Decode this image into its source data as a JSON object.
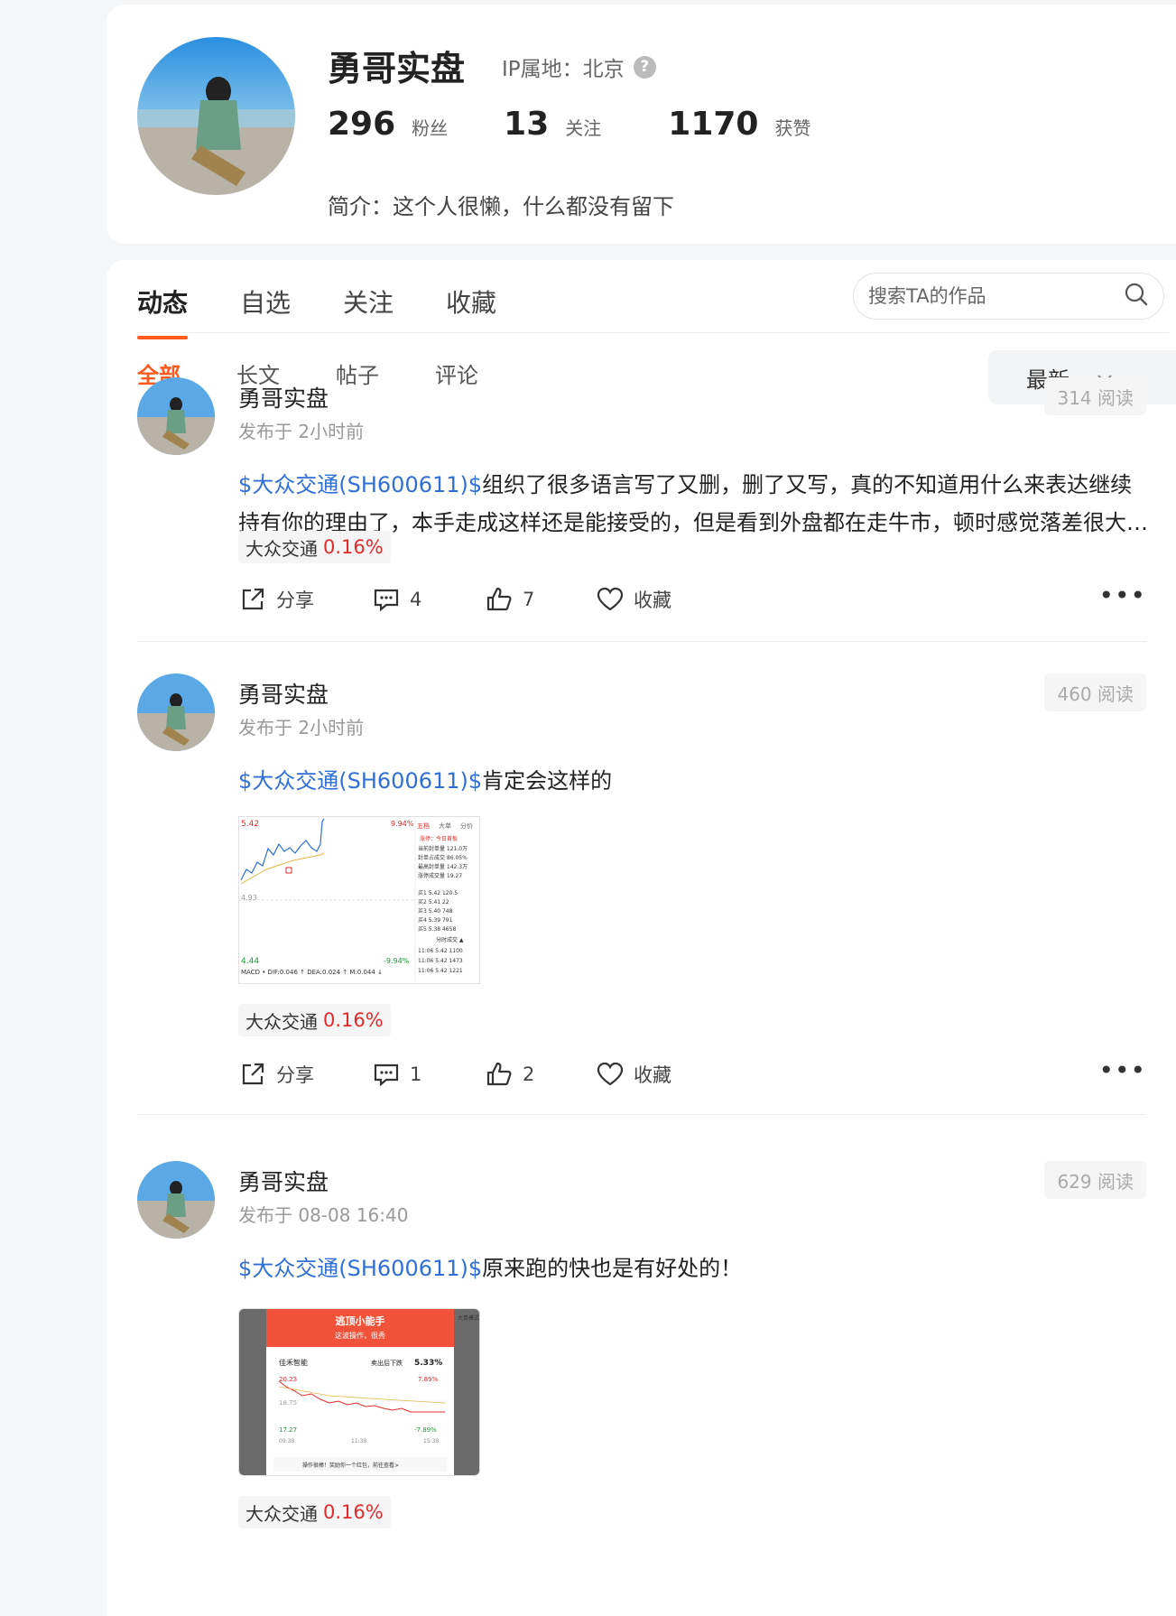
{
  "profile": {
    "name": "勇哥实盘",
    "ip_location": "IP属地：北京",
    "help_glyph": "?",
    "stats": [
      {
        "value": "296",
        "label": "粉丝"
      },
      {
        "value": "13",
        "label": "关注"
      },
      {
        "value": "1170",
        "label": "获赞"
      }
    ],
    "bio": "简介：这个人很懒，什么都没有留下"
  },
  "tabs": [
    "动态",
    "自选",
    "关注",
    "收藏"
  ],
  "search": {
    "placeholder": "搜索TA的作品"
  },
  "subtabs": [
    "全部",
    "长文",
    "帖子",
    "评论"
  ],
  "sort": {
    "selected": "最新"
  },
  "posts": [
    {
      "author": "勇哥实盘",
      "time": "发布于 2小时前",
      "reads": "314 阅读",
      "stock_link": "$大众交通(SH600611)$",
      "text": "组织了很多语言写了又删，删了又写，真的不知道用什么来表达继续持有你的理由了，本手走成这样还是能接受的，但是看到外盘都在走牛市，顿时感觉落差很大…",
      "tag_name": "大众交通",
      "tag_change": "0.16%",
      "share": "分享",
      "comments": "4",
      "likes": "7",
      "favorite": "收藏"
    },
    {
      "author": "勇哥实盘",
      "time": "发布于 2小时前",
      "reads": "460 阅读",
      "stock_link": "$大众交通(SH600611)$",
      "text": "肯定会这样的",
      "tag_name": "大众交通",
      "tag_change": "0.16%",
      "share": "分享",
      "comments": "1",
      "likes": "2",
      "favorite": "收藏",
      "image": {
        "price_high": "5.42",
        "pct_high": "9.94%",
        "price_mid": "4.93",
        "price_low": "4.44",
        "pct_low": "-9.94%",
        "macd": "MACD • DIF:0.046 ↑  DEA:0.024 ↑  M:0.044 ↓",
        "panel_tabs": [
          "五档",
          "大单",
          "分价"
        ],
        "board_lines": [
          "涨停：今日首板",
          "当前封单量 121.0万",
          "封单占成交 86.05%",
          "最高封单量 142.3万",
          "涨停成交量 19.27"
        ],
        "bids": [
          "买1  5.42  120.5",
          "买2  5.41  22",
          "买3  5.40  748",
          "买4  5.39  791",
          "买5  5.38  4658"
        ],
        "ticks_title": "分时成交 ▲",
        "ticks": [
          "11:06  5.42  1100",
          "11:06  5.42  1473",
          "11:06  5.42  1221"
        ]
      }
    },
    {
      "author": "勇哥实盘",
      "time": "发布于 08-08 16:40",
      "reads": "629 阅读",
      "stock_link": "$大众交通(SH600611)$",
      "text": "原来跑的快也是有好处的！",
      "tag_name": "大众交通",
      "tag_change": "0.16%",
      "image": {
        "banner_title": "逃顶小能手",
        "banner_sub": "这波操作，很秀",
        "stock": "佳禾智能",
        "drop_label": "卖出后下跌",
        "drop_value": "5.33%",
        "high": "20.23",
        "mid": "18.75",
        "low": "17.27",
        "pct_high": "7.89%",
        "pct_low": "-7.89%",
        "times": [
          "09:30",
          "11:30",
          "15:30"
        ],
        "footer": "操作很棒！奖励你一个红包，前往查看>",
        "side_title": "大单模式"
      }
    }
  ]
}
